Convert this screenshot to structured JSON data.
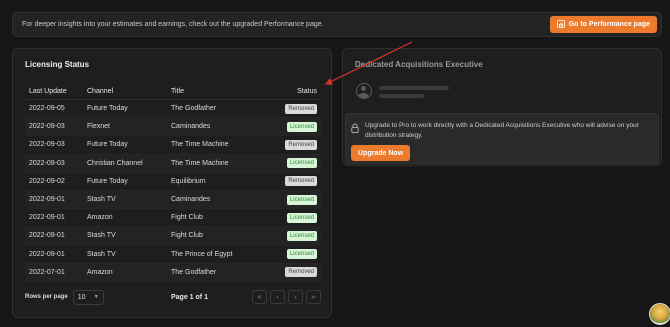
{
  "banner": {
    "text": "For deeper insights into your estimates and earnings, check out the upgraded Performance page.",
    "button_label": "Go to Performance page",
    "button_icon": "chart-icon"
  },
  "licensing": {
    "title": "Licensing Status",
    "columns": [
      "Last Update",
      "Channel",
      "Title",
      "Status"
    ],
    "rows": [
      {
        "date": "2022-09-05",
        "channel": "Future Today",
        "title": "The Godfather",
        "status": "Removed"
      },
      {
        "date": "2022-09-03",
        "channel": "Flexnet",
        "title": "Caminandes",
        "status": "Licensed"
      },
      {
        "date": "2022-09-03",
        "channel": "Future Today",
        "title": "The Time Machine",
        "status": "Removed"
      },
      {
        "date": "2022-09-03",
        "channel": "Christian Channel",
        "title": "The Time Machine",
        "status": "Licensed"
      },
      {
        "date": "2022-09-02",
        "channel": "Future Today",
        "title": "Equilibrium",
        "status": "Removed"
      },
      {
        "date": "2022-09-01",
        "channel": "Stash TV",
        "title": "Caminandes",
        "status": "Licensed"
      },
      {
        "date": "2022-09-01",
        "channel": "Amazon",
        "title": "Fight Club",
        "status": "Licensed"
      },
      {
        "date": "2022-09-01",
        "channel": "Stash TV",
        "title": "Fight Club",
        "status": "Licensed"
      },
      {
        "date": "2022-09-01",
        "channel": "Stash TV",
        "title": "The Prince of Egypt",
        "status": "Licensed"
      },
      {
        "date": "2022-07-01",
        "channel": "Amazon",
        "title": "The Godfather",
        "status": "Removed"
      }
    ],
    "pagination": {
      "rows_per_page_label": "Rows per page",
      "rows_per_page_value": "10",
      "page_info": "Page 1 of 1",
      "first": "«",
      "prev": "‹",
      "next": "›",
      "last": "»"
    }
  },
  "executive": {
    "title": "Dedicated Acquisitions Executive",
    "upgrade_text": "Upgrade to Pro to work directly with a Dedicated Acquisitions Executive who will advise on your distribution strategy.",
    "upgrade_button": "Upgrade Now"
  },
  "colors": {
    "accent": "#ec7a2d",
    "licensed_bg": "#d8f5d8",
    "licensed_text": "#2e8b3a",
    "removed_bg": "#d9d9d9",
    "arrow": "#d9342b"
  }
}
